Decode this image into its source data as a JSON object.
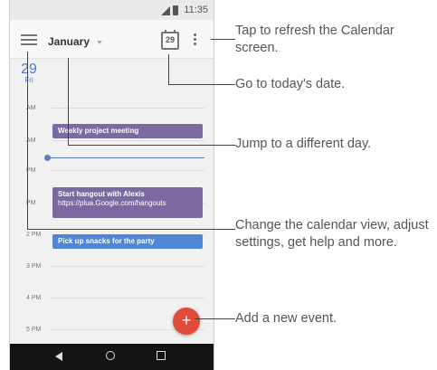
{
  "status_bar": {
    "time": "11:35"
  },
  "app_bar": {
    "month": "January",
    "today_date": "29"
  },
  "day_header": {
    "day_number": "29",
    "day_name": "Fri"
  },
  "hour_labels": [
    "AM",
    "AM",
    "PM",
    "PM",
    "2 PM",
    "3 PM",
    "4 PM",
    "5 PM"
  ],
  "events": [
    {
      "title": "Weekly project meeting",
      "subtitle": "",
      "color": "#7b6aa1"
    },
    {
      "title": "Start hangout with Alexis",
      "subtitle": "https://plua.Google.com/hangouts",
      "color": "#7b6aa1"
    },
    {
      "title": "Pick up snacks for the party",
      "subtitle": "",
      "color": "#4f86d6"
    }
  ],
  "fab": {
    "symbol": "+"
  },
  "colors": {
    "accent": "#4a7bd4",
    "fab": "#e04b3a",
    "event_purple": "#7b6aa1",
    "event_blue": "#4f86d6"
  },
  "callouts": {
    "refresh": "Tap to refresh the Calendar screen.",
    "today": "Go to today's date.",
    "jump": "Jump to a different day.",
    "view": "Change the calendar view, adjust settings, get help and more.",
    "add": "Add a new event."
  }
}
